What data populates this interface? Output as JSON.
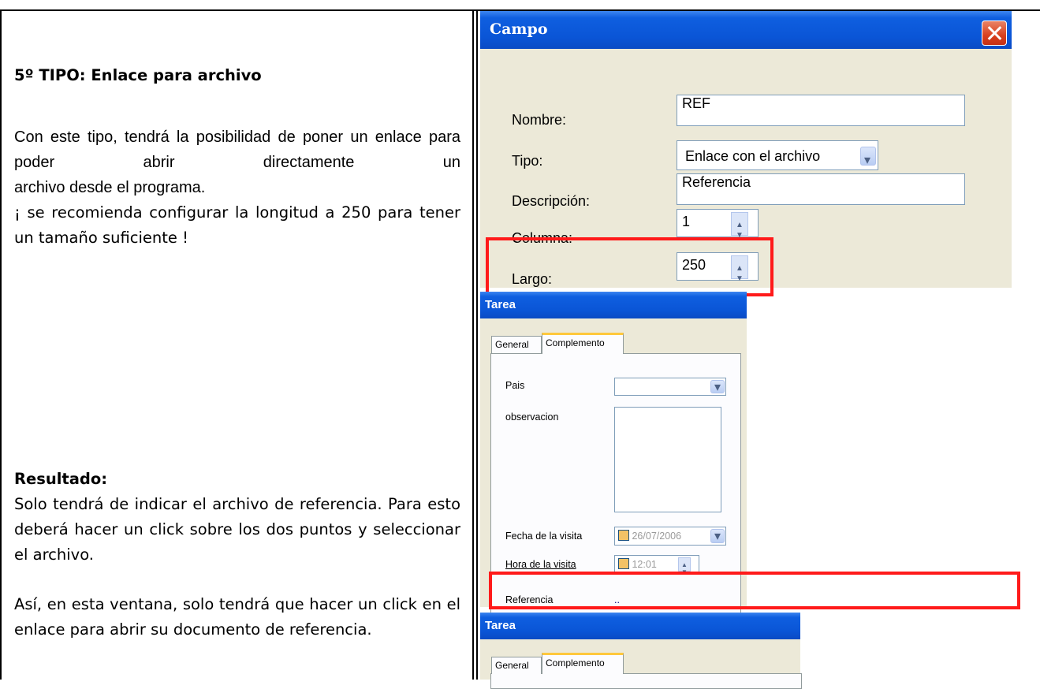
{
  "left": {
    "heading": "5º TIPO: Enlace para archivo",
    "p1_line1": "Con este tipo, tendrá la posibilidad de poner un enlace para poder abrir directamente un",
    "p1_line2": "archivo desde el programa.",
    "p2": "¡ se recomienda configurar la longitud a 250 para tener un tamaño suficiente !",
    "result_heading": "Resultado:",
    "result_text": "Solo tendrá de indicar el archivo de referencia. Para esto deberá hacer un click sobre los dos puntos y seleccionar el archivo.",
    "final_text": "Así, en esta ventana, solo tendrá que hacer un click en el enlace para abrir su documento de referencia."
  },
  "campo_dialog": {
    "title": "Campo",
    "nombre_label": "Nombre:",
    "nombre_value": "REF",
    "tipo_label": "Tipo:",
    "tipo_value": "Enlace con el archivo",
    "descripcion_label": "Descripción:",
    "descripcion_value": "Referencia",
    "columna_label": "Columna:",
    "columna_value": "1",
    "largo_label": "Largo:",
    "largo_value": "250"
  },
  "tarea_dialog": {
    "title": "Tarea",
    "tab_general": "General",
    "tab_complemento": "Complemento",
    "pais_label": "Pais",
    "observacion_label": "observacion",
    "fecha_label": "Fecha de la visita",
    "fecha_value": "26/07/2006",
    "hora_label": "Hora de la visita",
    "hora_value": "12:01",
    "referencia_label": "Referencia",
    "referencia_link": ".."
  },
  "tarea_dialog2": {
    "title": "Tarea",
    "tab_general": "General",
    "tab_complemento": "Complemento"
  },
  "colors": {
    "highlight": "#ff1a1a",
    "xp_title": "#0a55d6",
    "dialog_bg": "#ece9d8"
  }
}
